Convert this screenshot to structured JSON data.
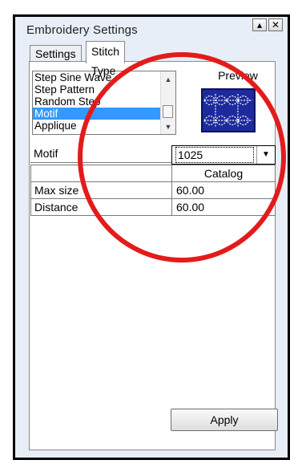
{
  "window": {
    "title": "Embroidery Settings",
    "buttons": {
      "minimize_glyph": "▴",
      "close_glyph": "✕"
    }
  },
  "tabs": [
    {
      "label": "Settings",
      "active": false
    },
    {
      "label": "Stitch Type",
      "active": true
    }
  ],
  "stitch_list": {
    "items": [
      "Step Sine Wave",
      "Step Pattern",
      "Random Step",
      "Motif",
      "Applique"
    ],
    "selected": "Motif",
    "scroll_up_glyph": "▲",
    "scroll_down_glyph": "▼"
  },
  "preview": {
    "label": "Preview",
    "background_color": "#1c2a9c"
  },
  "properties": {
    "motif": {
      "label": "Motif",
      "value": "1025",
      "dropdown_glyph": "▼"
    },
    "catalog": {
      "label": "",
      "value": "Catalog"
    },
    "max_size": {
      "label": "Max size",
      "value": "60.00"
    },
    "distance": {
      "label": "Distance",
      "value": "60.00"
    }
  },
  "footer": {
    "apply_label": "Apply"
  },
  "colors": {
    "selection": "#3399ff",
    "highlight_circle": "#e41b1b",
    "window_bg": "#e8eef7"
  }
}
